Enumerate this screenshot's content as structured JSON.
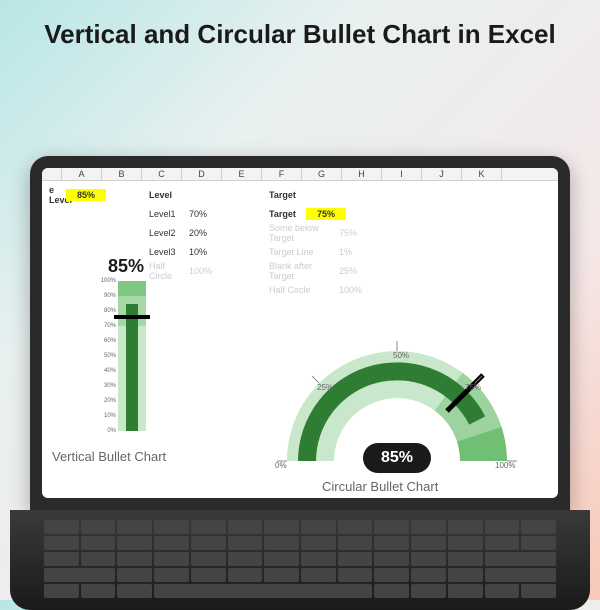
{
  "page": {
    "title": "Vertical and Circular Bullet Chart in Excel"
  },
  "excel": {
    "columns": [
      "A",
      "B",
      "C",
      "D",
      "E",
      "F",
      "G",
      "H",
      "I",
      "J",
      "K"
    ],
    "row1": {
      "label_a": "e Level",
      "value_b": "85%",
      "level_header": "Level",
      "target_header": "Target"
    },
    "levels": [
      {
        "name": "Level1",
        "value": "70%"
      },
      {
        "name": "Level2",
        "value": "20%"
      },
      {
        "name": "Level3",
        "value": "10%"
      }
    ],
    "target_row": {
      "label": "Target",
      "value": "75%"
    },
    "faded_rows": [
      {
        "label": "Some below Target",
        "value": "75%"
      },
      {
        "label": "Target Line",
        "value": "1%"
      },
      {
        "label": "Blank after Target",
        "value": "25%"
      },
      {
        "label": "Half Circle",
        "value": "100%"
      }
    ],
    "helper": {
      "half_circle": "Half Circle",
      "pct": "100%"
    }
  },
  "vertical_chart": {
    "title": "Vertical Bullet Chart",
    "value_label": "85%",
    "ticks": [
      "0%",
      "10%",
      "20%",
      "30%",
      "40%",
      "50%",
      "60%",
      "70%",
      "80%",
      "90%",
      "100%"
    ]
  },
  "circular_chart": {
    "title": "Circular Bullet Chart",
    "value_label": "85%",
    "ticks": [
      {
        "t": "0%",
        "x": 28,
        "y": 150
      },
      {
        "t": "25%",
        "x": 70,
        "y": 72
      },
      {
        "t": "50%",
        "x": 146,
        "y": 40
      },
      {
        "t": "75%",
        "x": 218,
        "y": 72
      },
      {
        "t": "100%",
        "x": 248,
        "y": 150
      }
    ]
  },
  "chart_data": [
    {
      "type": "bullet",
      "orientation": "vertical",
      "title": "Vertical Bullet Chart",
      "value": 85,
      "target": 75,
      "bands": [
        {
          "name": "Level1",
          "range": [
            0,
            70
          ]
        },
        {
          "name": "Level2",
          "range": [
            70,
            90
          ]
        },
        {
          "name": "Level3",
          "range": [
            90,
            100
          ]
        }
      ],
      "ylim": [
        0,
        100
      ],
      "unit": "%"
    },
    {
      "type": "bullet",
      "orientation": "circular",
      "title": "Circular Bullet Chart",
      "value": 85,
      "target": 75,
      "bands": [
        {
          "name": "Level1",
          "range": [
            0,
            70
          ]
        },
        {
          "name": "Level2",
          "range": [
            70,
            90
          ]
        },
        {
          "name": "Level3",
          "range": [
            90,
            100
          ]
        }
      ],
      "ticks": [
        0,
        25,
        50,
        75,
        100
      ],
      "unit": "%"
    }
  ]
}
